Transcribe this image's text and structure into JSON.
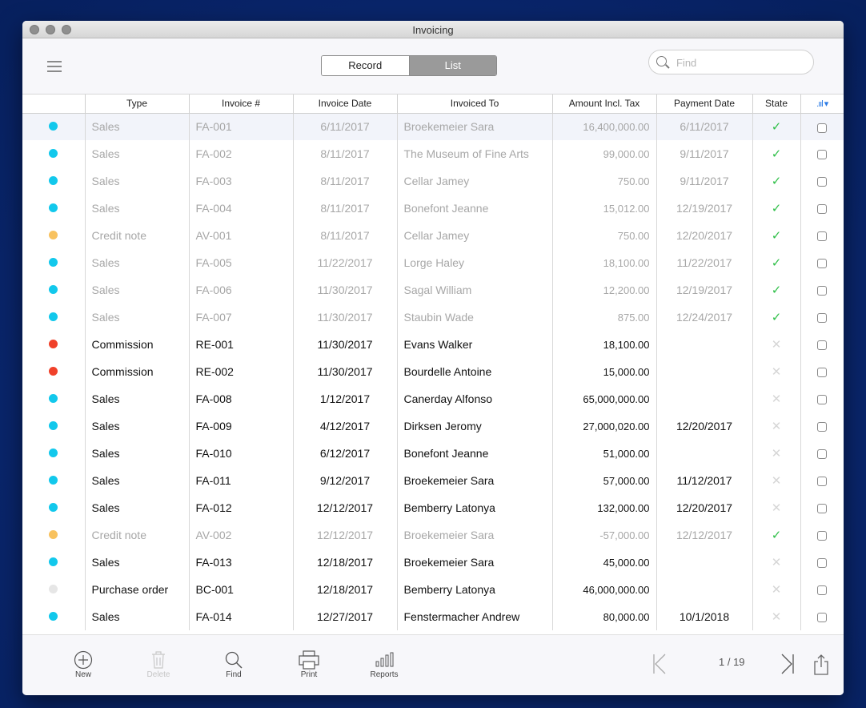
{
  "window": {
    "title": "Invoicing"
  },
  "toolbar": {
    "segments": {
      "record": "Record",
      "list": "List"
    },
    "search_placeholder": "Find"
  },
  "table": {
    "columns": [
      "",
      "Type",
      "Invoice #",
      "Invoice Date",
      "Invoiced To",
      "Amount Incl. Tax",
      "Payment Date",
      "State",
      ""
    ],
    "rows": [
      {
        "color": "#12c8ec",
        "style": "pale",
        "type": "Sales",
        "invoice": "FA-001",
        "date": "6/11/2017",
        "to": "Broekemeier Sara",
        "amount": "16,400,000.00",
        "payment": "6/11/2017",
        "state": "paid"
      },
      {
        "color": "#12c8ec",
        "style": "pale",
        "type": "Sales",
        "invoice": "FA-002",
        "date": "8/11/2017",
        "to": "The Museum of Fine Arts",
        "amount": "99,000.00",
        "payment": "9/11/2017",
        "state": "paid"
      },
      {
        "color": "#12c8ec",
        "style": "pale",
        "type": "Sales",
        "invoice": "FA-003",
        "date": "8/11/2017",
        "to": "Cellar Jamey",
        "amount": "750.00",
        "payment": "9/11/2017",
        "state": "paid"
      },
      {
        "color": "#12c8ec",
        "style": "pale",
        "type": "Sales",
        "invoice": "FA-004",
        "date": "8/11/2017",
        "to": "Bonefont Jeanne",
        "amount": "15,012.00",
        "payment": "12/19/2017",
        "state": "paid"
      },
      {
        "color": "#f8c25f",
        "style": "pale",
        "type": "Credit note",
        "invoice": "AV-001",
        "date": "8/11/2017",
        "to": "Cellar Jamey",
        "amount": "750.00",
        "payment": "12/20/2017",
        "state": "paid"
      },
      {
        "color": "#12c8ec",
        "style": "pale",
        "type": "Sales",
        "invoice": "FA-005",
        "date": "11/22/2017",
        "to": "Lorge Haley",
        "amount": "18,100.00",
        "payment": "11/22/2017",
        "state": "paid"
      },
      {
        "color": "#12c8ec",
        "style": "pale",
        "type": "Sales",
        "invoice": "FA-006",
        "date": "11/30/2017",
        "to": "Sagal William",
        "amount": "12,200.00",
        "payment": "12/19/2017",
        "state": "paid"
      },
      {
        "color": "#12c8ec",
        "style": "pale",
        "type": "Sales",
        "invoice": "FA-007",
        "date": "11/30/2017",
        "to": "Staubin Wade",
        "amount": "875.00",
        "payment": "12/24/2017",
        "state": "paid"
      },
      {
        "color": "#f0412a",
        "style": "bold",
        "type": "Commission",
        "invoice": "RE-001",
        "date": "11/30/2017",
        "to": "Evans Walker",
        "amount": "18,100.00",
        "payment": "",
        "state": "unpaid"
      },
      {
        "color": "#f0412a",
        "style": "bold",
        "type": "Commission",
        "invoice": "RE-002",
        "date": "11/30/2017",
        "to": "Bourdelle Antoine",
        "amount": "15,000.00",
        "payment": "",
        "state": "unpaid"
      },
      {
        "color": "#12c8ec",
        "style": "bold",
        "type": "Sales",
        "invoice": "FA-008",
        "date": "1/12/2017",
        "to": "Canerday Alfonso",
        "amount": "65,000,000.00",
        "payment": "",
        "state": "unpaid"
      },
      {
        "color": "#12c8ec",
        "style": "bold",
        "type": "Sales",
        "invoice": "FA-009",
        "date": "4/12/2017",
        "to": "Dirksen Jeromy",
        "amount": "27,000,020.00",
        "payment": "12/20/2017",
        "state": "unpaid"
      },
      {
        "color": "#12c8ec",
        "style": "bold",
        "type": "Sales",
        "invoice": "FA-010",
        "date": "6/12/2017",
        "to": "Bonefont Jeanne",
        "amount": "51,000.00",
        "payment": "",
        "state": "unpaid"
      },
      {
        "color": "#12c8ec",
        "style": "bold",
        "type": "Sales",
        "invoice": "FA-011",
        "date": "9/12/2017",
        "to": "Broekemeier Sara",
        "amount": "57,000.00",
        "payment": "11/12/2017",
        "state": "unpaid"
      },
      {
        "color": "#12c8ec",
        "style": "bold",
        "type": "Sales",
        "invoice": "FA-012",
        "date": "12/12/2017",
        "to": "Bemberry Latonya",
        "amount": "132,000.00",
        "payment": "12/20/2017",
        "state": "unpaid"
      },
      {
        "color": "#f8c25f",
        "style": "pale",
        "type": "Credit note",
        "invoice": "AV-002",
        "date": "12/12/2017",
        "to": "Broekemeier Sara",
        "amount": "-57,000.00",
        "payment": "12/12/2017",
        "state": "paid"
      },
      {
        "color": "#12c8ec",
        "style": "bold",
        "type": "Sales",
        "invoice": "FA-013",
        "date": "12/18/2017",
        "to": "Broekemeier Sara",
        "amount": "45,000.00",
        "payment": "",
        "state": "unpaid"
      },
      {
        "color": "#e6e6e6",
        "style": "bold",
        "type": "Purchase order",
        "invoice": "BC-001",
        "date": "12/18/2017",
        "to": "Bemberry Latonya",
        "amount": "46,000,000.00",
        "payment": "",
        "state": "unpaid"
      },
      {
        "color": "#12c8ec",
        "style": "bold",
        "type": "Sales",
        "invoice": "FA-014",
        "date": "12/27/2017",
        "to": "Fenstermacher Andrew",
        "amount": "80,000.00",
        "payment": "10/1/2018",
        "state": "unpaid"
      }
    ]
  },
  "bottom": {
    "new": "New",
    "delete": "Delete",
    "find": "Find",
    "print": "Print",
    "reports": "Reports",
    "page": "1 / 19"
  },
  "colors": {
    "paid_check": "#2fbf48",
    "selection": "#f2f4fa"
  }
}
